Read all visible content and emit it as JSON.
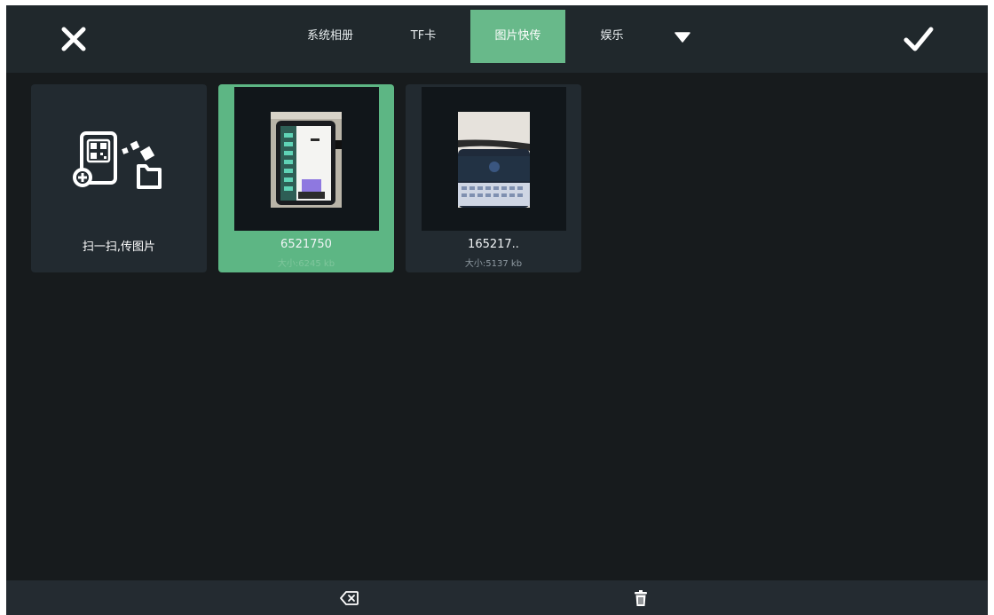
{
  "topbar": {
    "close_icon": "close-icon",
    "confirm_icon": "checkmark-icon",
    "tabs": [
      {
        "label": "系统相册",
        "active": false
      },
      {
        "label": "TF卡",
        "active": false
      },
      {
        "label": "图片快传",
        "active": true
      },
      {
        "label": "娱乐",
        "active": false
      }
    ],
    "more_icon": "caret-down-icon"
  },
  "grid": {
    "scan_card": {
      "label": "扫一扫,传图片",
      "icon": "qr-phone-transfer-icon"
    },
    "photos": [
      {
        "name": "6521750",
        "size": "大小:6245 kb",
        "selected": true
      },
      {
        "name": "165217..",
        "size": "大小:5137 kb",
        "selected": false
      }
    ]
  },
  "bottombar": {
    "backspace_icon": "backspace-icon",
    "delete_icon": "trash-icon"
  },
  "colors": {
    "accent": "#68b98a",
    "background": "#171b1d",
    "topbar": "#20282c"
  }
}
